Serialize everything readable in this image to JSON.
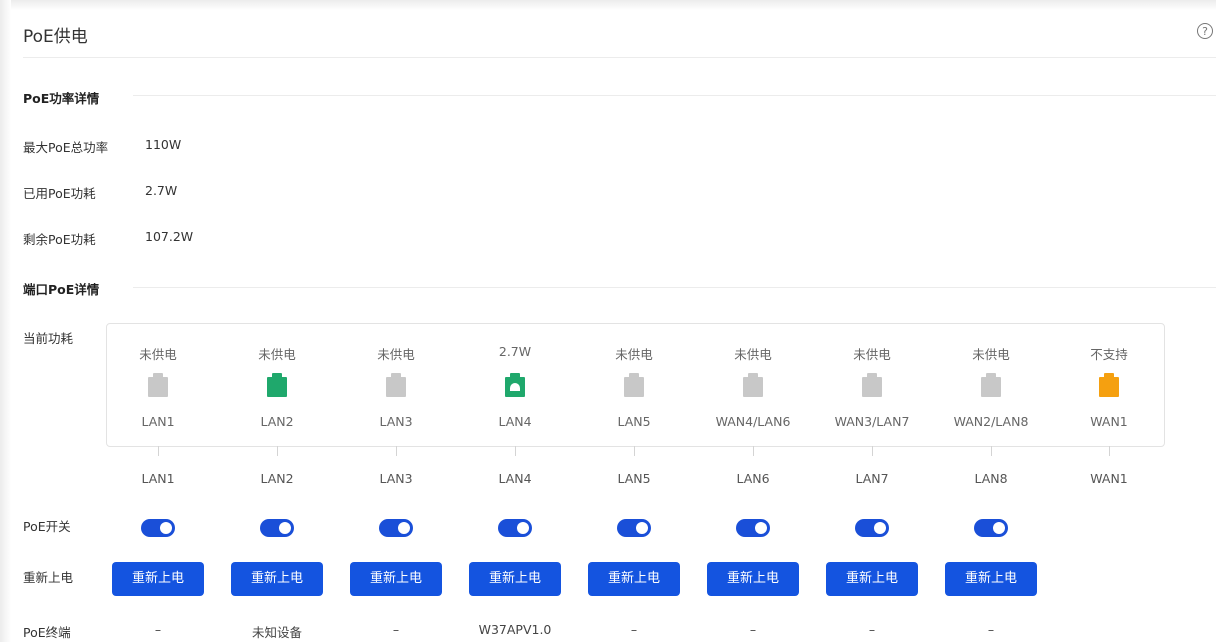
{
  "page_title": "PoE供电",
  "help_icon": "?",
  "power_section": {
    "title": "PoE功率详情",
    "rows": [
      {
        "label": "最大PoE总功率",
        "value": "110W"
      },
      {
        "label": "已用PoE功耗",
        "value": "2.7W"
      },
      {
        "label": "剩余PoE功耗",
        "value": "107.2W"
      }
    ]
  },
  "port_section": {
    "title": "端口PoE详情",
    "current_power_label": "当前功耗",
    "poe_switch_label": "PoE开关",
    "restart_label": "重新上电",
    "terminal_label": "PoE终端",
    "colors": {
      "gray": "#c8c8c8",
      "green": "#1fa86c",
      "orange": "#f5a010",
      "toggle": "#1a4fd8",
      "button": "#1454e0"
    },
    "ports": [
      {
        "power": "未供电",
        "name": "LAN1",
        "bottom": "LAN1",
        "status": "gray",
        "switch_on": true,
        "button": "重新上电",
        "terminal": "–"
      },
      {
        "power": "未供电",
        "name": "LAN2",
        "bottom": "LAN2",
        "status": "green",
        "switch_on": true,
        "button": "重新上电",
        "terminal": "未知设备"
      },
      {
        "power": "未供电",
        "name": "LAN3",
        "bottom": "LAN3",
        "status": "gray",
        "switch_on": true,
        "button": "重新上电",
        "terminal": "–"
      },
      {
        "power": "2.7W",
        "name": "LAN4",
        "bottom": "LAN4",
        "status": "green-powered",
        "switch_on": true,
        "button": "重新上电",
        "terminal": "W37APV1.0"
      },
      {
        "power": "未供电",
        "name": "LAN5",
        "bottom": "LAN5",
        "status": "gray",
        "switch_on": true,
        "button": "重新上电",
        "terminal": "–"
      },
      {
        "power": "未供电",
        "name": "WAN4/LAN6",
        "bottom": "LAN6",
        "status": "gray",
        "switch_on": true,
        "button": "重新上电",
        "terminal": "–"
      },
      {
        "power": "未供电",
        "name": "WAN3/LAN7",
        "bottom": "LAN7",
        "status": "gray",
        "switch_on": true,
        "button": "重新上电",
        "terminal": "–"
      },
      {
        "power": "未供电",
        "name": "WAN2/LAN8",
        "bottom": "LAN8",
        "status": "gray",
        "switch_on": true,
        "button": "重新上电",
        "terminal": "–"
      },
      {
        "power": "不支持",
        "name": "WAN1",
        "bottom": "WAN1",
        "status": "orange"
      }
    ]
  }
}
